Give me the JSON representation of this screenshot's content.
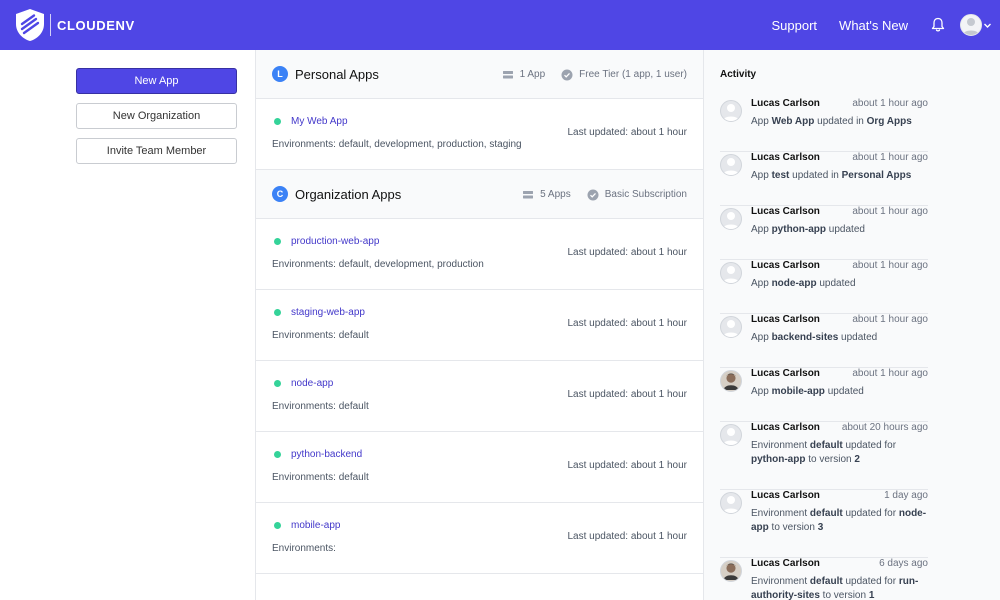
{
  "header": {
    "brand": "CLOUDENV",
    "nav": {
      "support": "Support",
      "whats_new": "What's New"
    },
    "icons": [
      "shield-logo-icon",
      "bell-icon",
      "avatar-icon",
      "chevron-down-icon"
    ],
    "color": "#4f46e5"
  },
  "sidebar": {
    "new_app": "New App",
    "new_org": "New Organization",
    "invite": "Invite Team Member"
  },
  "personal": {
    "badge": "L",
    "title": "Personal Apps",
    "count": "1 App",
    "plan": "Free Tier (1 app, 1 user)",
    "apps": [
      {
        "name": "My Web App",
        "env": "Environments: default, development, production, staging",
        "updated": "Last updated: about 1 hour"
      }
    ]
  },
  "org": {
    "badge": "C",
    "title": "Organization Apps",
    "count": "5 Apps",
    "plan": "Basic Subscription",
    "apps": [
      {
        "name": "production-web-app",
        "env": "Environments: default, development, production",
        "updated": "Last updated: about 1 hour"
      },
      {
        "name": "staging-web-app",
        "env": "Environments: default",
        "updated": "Last updated: about 1 hour"
      },
      {
        "name": "node-app",
        "env": "Environments: default",
        "updated": "Last updated: about 1 hour"
      },
      {
        "name": "python-backend",
        "env": "Environments: default",
        "updated": "Last updated: about 1 hour"
      },
      {
        "name": "mobile-app",
        "env": "Environments:",
        "updated": "Last updated: about 1 hour"
      }
    ]
  },
  "activity": {
    "title": "Activity",
    "items": [
      {
        "user": "Lucas Carlson",
        "time": "about 1 hour ago",
        "parts": [
          "App ",
          "Web App",
          " updated in ",
          "Org Apps",
          ""
        ]
      },
      {
        "user": "Lucas Carlson",
        "time": "about 1 hour ago",
        "parts": [
          "App ",
          "test",
          " updated in ",
          "Personal Apps",
          ""
        ]
      },
      {
        "user": "Lucas Carlson",
        "time": "about 1 hour ago",
        "parts": [
          "App ",
          "python-app",
          " updated",
          "",
          ""
        ]
      },
      {
        "user": "Lucas Carlson",
        "time": "about 1 hour ago",
        "parts": [
          "App ",
          "node-app",
          " updated",
          "",
          ""
        ]
      },
      {
        "user": "Lucas Carlson",
        "time": "about 1 hour ago",
        "parts": [
          "App ",
          "backend-sites",
          " updated",
          "",
          ""
        ]
      },
      {
        "user": "Lucas Carlson",
        "time": "about 1 hour ago",
        "parts": [
          "App ",
          "mobile-app",
          " updated",
          "",
          ""
        ]
      },
      {
        "user": "Lucas Carlson",
        "time": "about 20 hours ago",
        "parts": [
          "Environment ",
          "default",
          " updated for ",
          "python-app",
          " to version ",
          "2"
        ]
      },
      {
        "user": "Lucas Carlson",
        "time": "1 day ago",
        "parts": [
          "Environment ",
          "default",
          " updated for ",
          "node-app",
          " to version ",
          "3"
        ]
      },
      {
        "user": "Lucas Carlson",
        "time": "6 days ago",
        "parts": [
          "Environment ",
          "default",
          " updated for ",
          "run-authority-sites",
          " to version ",
          "1"
        ]
      }
    ]
  }
}
